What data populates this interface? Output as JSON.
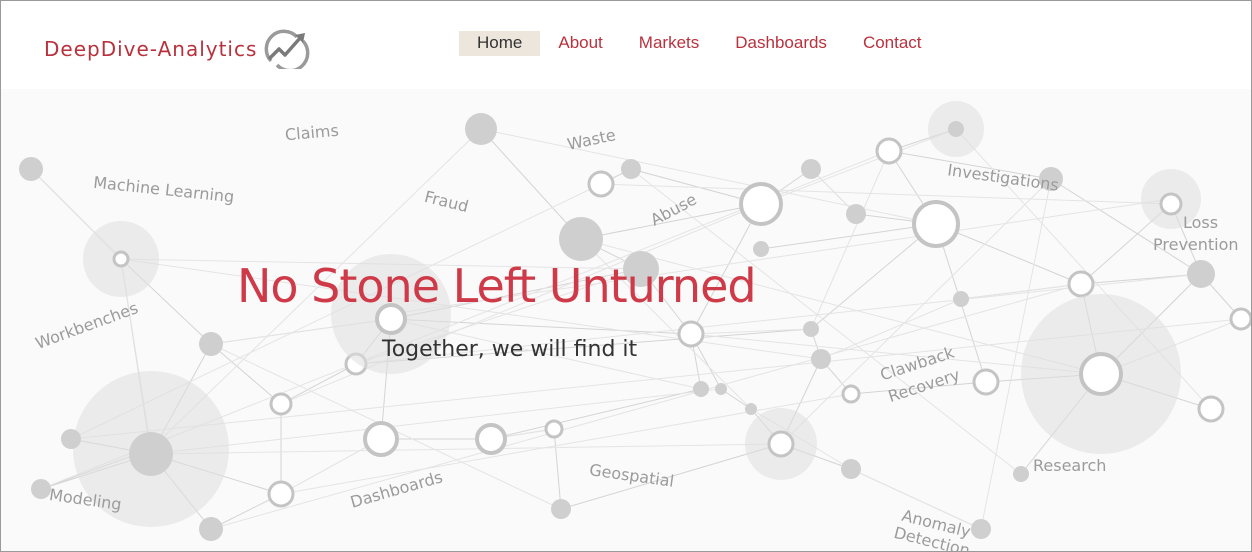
{
  "header": {
    "logo_text": "DeepDive-Analytics",
    "logo_icon": "rising-trend-arrow-icon",
    "nav": [
      {
        "label": "Home",
        "active": true
      },
      {
        "label": "About",
        "active": false
      },
      {
        "label": "Markets",
        "active": false
      },
      {
        "label": "Dashboards",
        "active": false
      },
      {
        "label": "Contact",
        "active": false
      }
    ]
  },
  "hero": {
    "title": "No Stone Left Unturned",
    "subtitle": "Together, we will find it",
    "tags": {
      "claims": "Claims",
      "waste": "Waste",
      "machine_learning": "Machine Learning",
      "fraud": "Fraud",
      "abuse": "Abuse",
      "investigations": "Investigations",
      "loss": "Loss",
      "prevention": "Prevention",
      "workbenches": "Workbenches",
      "clawback": "Clawback",
      "recovery": "Recovery",
      "research": "Research",
      "modeling": "Modeling",
      "dashboards": "Dashboards",
      "geospatial": "Geospatial",
      "anomaly": "Anomaly",
      "detection": "Detection"
    }
  },
  "colors": {
    "brand_red": "#cf3a48",
    "logo_red": "#b8323d",
    "active_nav_bg": "#ece6dd",
    "network_gray": "#c8c8c8"
  }
}
